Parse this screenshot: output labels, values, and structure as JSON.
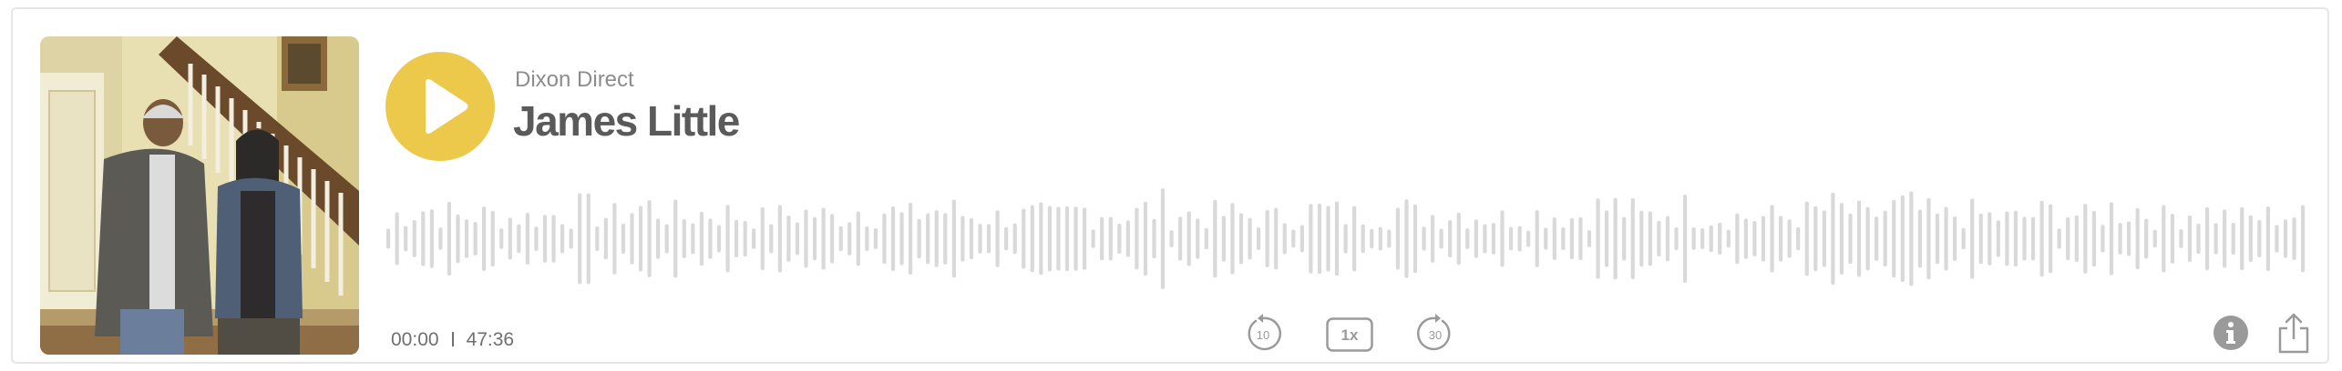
{
  "episode": {
    "show_title": "Dixon Direct",
    "episode_title": "James Little"
  },
  "playback": {
    "current_time": "00:00",
    "duration": "47:36",
    "progress": 0,
    "speed_label": "1x",
    "skip_back_label": "10",
    "skip_forward_label": "30"
  },
  "icons": {
    "play": "play-icon",
    "skip_back": "rewind-10-icon",
    "speed": "playback-speed-icon",
    "skip_forward": "forward-30-icon",
    "info": "info-icon",
    "share": "share-icon"
  },
  "colors": {
    "accent": "#ecc94b",
    "waveform": "#d9d9d9",
    "title_text": "#5a5a5a",
    "subtitle_text": "#8c8c8c",
    "control_gray": "#9a9a9a",
    "border": "#e6e6e6"
  }
}
